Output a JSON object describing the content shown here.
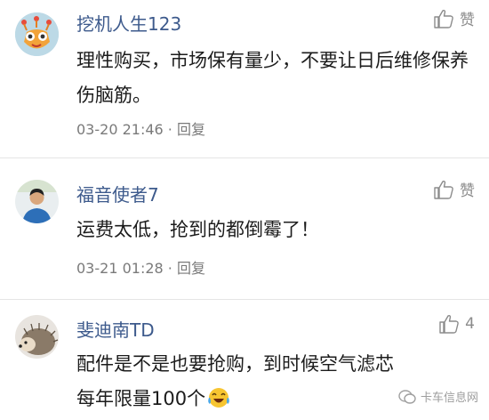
{
  "comments": [
    {
      "username": "挖机人生123",
      "like_label": "赞",
      "content": "理性购买，市场保有量少，不要让日后维修保养伤脑筋。",
      "timestamp": "03-20 21:46",
      "separator": "·",
      "reply_label": "回复"
    },
    {
      "username": "福音使者7",
      "like_label": "赞",
      "content": "运费太低，抢到的都倒霉了！",
      "timestamp": "03-21 01:28",
      "separator": "·",
      "reply_label": "回复"
    },
    {
      "username": "斐迪南TD",
      "like_count": "4",
      "content_line1": "配件是不是也要抢购，到时候空气滤芯",
      "content_line2": "每年限量100个"
    }
  ],
  "watermark": "卡车信息网",
  "colors": {
    "username": "#3d5a8c",
    "text": "#1c1c1c",
    "meta": "#7a7a7a",
    "like": "#8b8b8b"
  },
  "icons": {
    "like": "thumbs-up-icon",
    "emoji": "laughing-crying-emoji-icon",
    "watermark": "wechat-logo-icon"
  }
}
